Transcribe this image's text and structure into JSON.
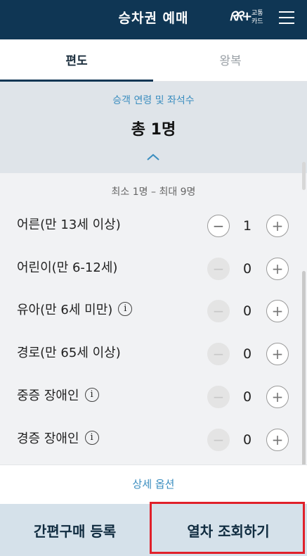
{
  "header": {
    "title": "승차권 예매",
    "card_logo": "ᖇᖇ+",
    "card_line1": "교통",
    "card_line2": "카드"
  },
  "tabs": [
    {
      "label": "편도",
      "active": true
    },
    {
      "label": "왕복",
      "active": false
    }
  ],
  "summary": {
    "label": "승객 연령 및 좌석수",
    "total": "총 1명"
  },
  "range_note": "최소 1명 – 최대 9명",
  "passengers": [
    {
      "label": "어른(만 13세 이상)",
      "count": "1",
      "info": false,
      "minus_enabled": true
    },
    {
      "label": "어린이(만 6-12세)",
      "count": "0",
      "info": false,
      "minus_enabled": false
    },
    {
      "label": "유아(만 6세 미만)",
      "count": "0",
      "info": true,
      "minus_enabled": false
    },
    {
      "label": "경로(만 65세 이상)",
      "count": "0",
      "info": false,
      "minus_enabled": false
    },
    {
      "label": "중증 장애인",
      "count": "0",
      "info": true,
      "minus_enabled": false
    },
    {
      "label": "경증 장애인",
      "count": "0",
      "info": true,
      "minus_enabled": false
    }
  ],
  "glyphs": {
    "minus": "−",
    "plus": "+",
    "info": "i"
  },
  "detail_options": "상세 옵션",
  "bottom": {
    "left_label": "간편구매 등록",
    "right_label": "열차 조회하기"
  },
  "colors": {
    "header_bg": "#0f3654",
    "accent_blue": "#3a8dbf",
    "summary_bg": "#dfe4e9",
    "bottom_bg": "#d5e1ea",
    "highlight_red": "#e0202a"
  }
}
